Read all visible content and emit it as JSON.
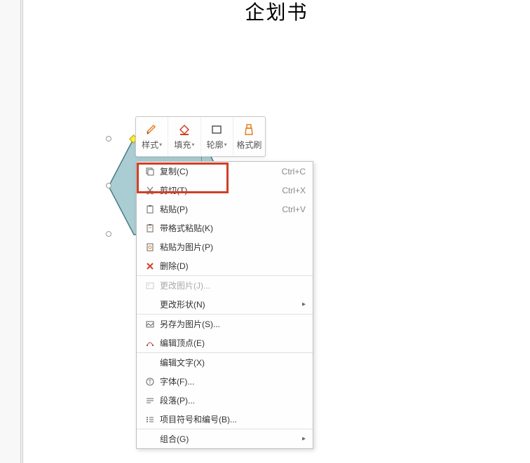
{
  "pageTitle": "企划书",
  "toolbar": {
    "style": "样式",
    "fill": "填充",
    "outline": "轮廓",
    "formatPainter": "格式刷"
  },
  "menu": {
    "copy": {
      "label": "复制(C)",
      "shortcut": "Ctrl+C"
    },
    "cut": {
      "label": "剪切(T)",
      "shortcut": "Ctrl+X"
    },
    "paste": {
      "label": "粘贴(P)",
      "shortcut": "Ctrl+V"
    },
    "pasteFormat": {
      "label": "带格式粘贴(K)"
    },
    "pasteAsPicture": {
      "label": "粘贴为图片(P)"
    },
    "delete": {
      "label": "删除(D)"
    },
    "changePicture": {
      "label": "更改图片(J)..."
    },
    "changeShape": {
      "label": "更改形状(N)"
    },
    "saveAsPicture": {
      "label": "另存为图片(S)..."
    },
    "editPoints": {
      "label": "编辑顶点(E)"
    },
    "editText": {
      "label": "编辑文字(X)"
    },
    "font": {
      "label": "字体(F)..."
    },
    "paragraph": {
      "label": "段落(P)..."
    },
    "bullets": {
      "label": "项目符号和编号(B)..."
    },
    "group": {
      "label": "组合(G)"
    }
  },
  "colors": {
    "hexagonFill": "#a9cdd2",
    "hexagonStroke": "#4a7a85",
    "highlight": "#d04028",
    "brushOrange": "#e67e22"
  }
}
